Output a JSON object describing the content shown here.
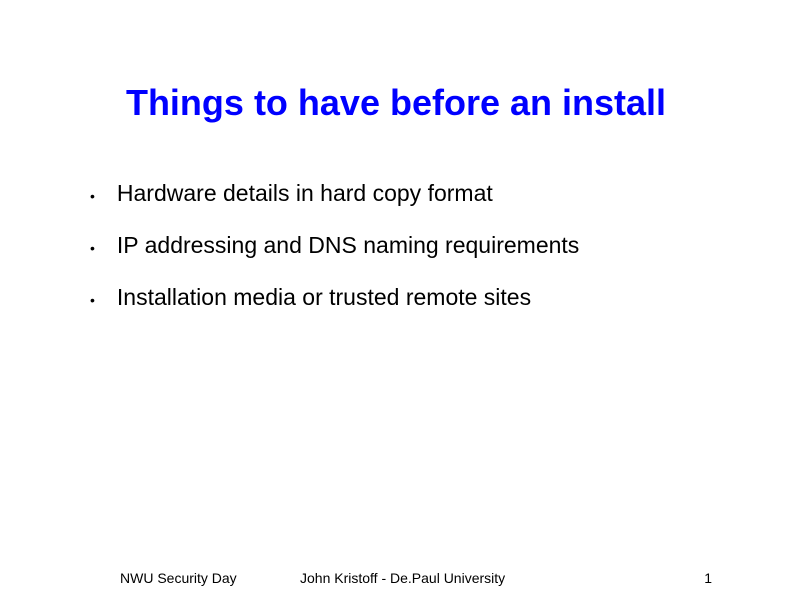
{
  "title": "Things to have before an install",
  "bullets": [
    "Hardware details in hard copy format",
    "IP addressing and DNS naming requirements",
    "Installation media or trusted remote sites"
  ],
  "footer": {
    "left": "NWU Security Day",
    "center": "John Kristoff - De.Paul University",
    "right": "1"
  }
}
